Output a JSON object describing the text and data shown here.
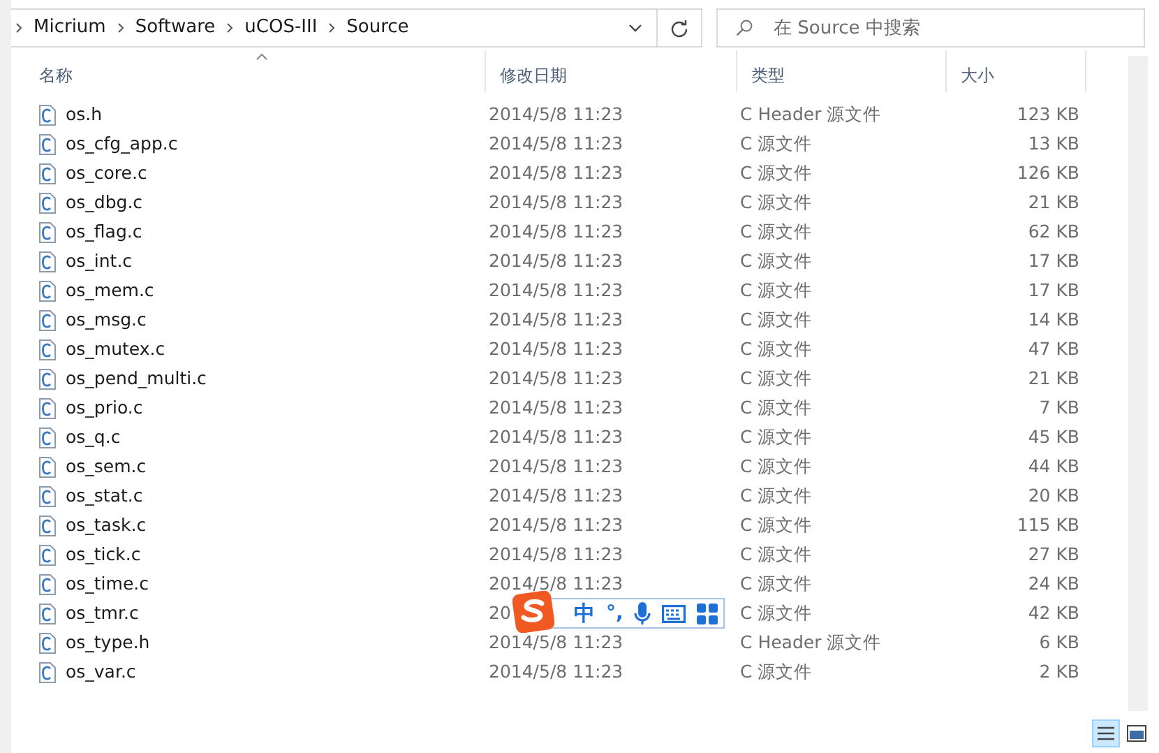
{
  "address_bar": {
    "path": [
      "Micrium",
      "Software",
      "uCOS-III",
      "Source"
    ]
  },
  "search": {
    "placeholder": "在 Source 中搜索"
  },
  "table": {
    "columns": [
      {
        "label": "名称",
        "sorted": true
      },
      {
        "label": "修改日期",
        "sorted": false
      },
      {
        "label": "类型",
        "sorted": false
      },
      {
        "label": "大小",
        "sorted": false
      }
    ],
    "rows": [
      {
        "name": "os.h",
        "date": "2014/5/8 11:23",
        "type": "C Header 源文件",
        "size": "123 KB"
      },
      {
        "name": "os_cfg_app.c",
        "date": "2014/5/8 11:23",
        "type": "C 源文件",
        "size": "13 KB"
      },
      {
        "name": "os_core.c",
        "date": "2014/5/8 11:23",
        "type": "C 源文件",
        "size": "126 KB"
      },
      {
        "name": "os_dbg.c",
        "date": "2014/5/8 11:23",
        "type": "C 源文件",
        "size": "21 KB"
      },
      {
        "name": "os_flag.c",
        "date": "2014/5/8 11:23",
        "type": "C 源文件",
        "size": "62 KB"
      },
      {
        "name": "os_int.c",
        "date": "2014/5/8 11:23",
        "type": "C 源文件",
        "size": "17 KB"
      },
      {
        "name": "os_mem.c",
        "date": "2014/5/8 11:23",
        "type": "C 源文件",
        "size": "17 KB"
      },
      {
        "name": "os_msg.c",
        "date": "2014/5/8 11:23",
        "type": "C 源文件",
        "size": "14 KB"
      },
      {
        "name": "os_mutex.c",
        "date": "2014/5/8 11:23",
        "type": "C 源文件",
        "size": "47 KB"
      },
      {
        "name": "os_pend_multi.c",
        "date": "2014/5/8 11:23",
        "type": "C 源文件",
        "size": "21 KB"
      },
      {
        "name": "os_prio.c",
        "date": "2014/5/8 11:23",
        "type": "C 源文件",
        "size": "7 KB"
      },
      {
        "name": "os_q.c",
        "date": "2014/5/8 11:23",
        "type": "C 源文件",
        "size": "45 KB"
      },
      {
        "name": "os_sem.c",
        "date": "2014/5/8 11:23",
        "type": "C 源文件",
        "size": "44 KB"
      },
      {
        "name": "os_stat.c",
        "date": "2014/5/8 11:23",
        "type": "C 源文件",
        "size": "20 KB"
      },
      {
        "name": "os_task.c",
        "date": "2014/5/8 11:23",
        "type": "C 源文件",
        "size": "115 KB"
      },
      {
        "name": "os_tick.c",
        "date": "2014/5/8 11:23",
        "type": "C 源文件",
        "size": "27 KB"
      },
      {
        "name": "os_time.c",
        "date": "2014/5/8 11:23",
        "type": "C 源文件",
        "size": "24 KB"
      },
      {
        "name": "os_tmr.c",
        "date": "20",
        "type": "C 源文件",
        "size": "42 KB"
      },
      {
        "name": "os_type.h",
        "date": "2014/5/8 11:23",
        "type": "C Header 源文件",
        "size": "6 KB"
      },
      {
        "name": "os_var.c",
        "date": "2014/5/8 11:23",
        "type": "C 源文件",
        "size": "2 KB"
      }
    ]
  },
  "ime_toolbar": {
    "mode": "中",
    "punct": "°,"
  },
  "view_buttons": [
    {
      "kind": "details",
      "selected": true
    },
    {
      "kind": "large",
      "selected": false
    }
  ]
}
